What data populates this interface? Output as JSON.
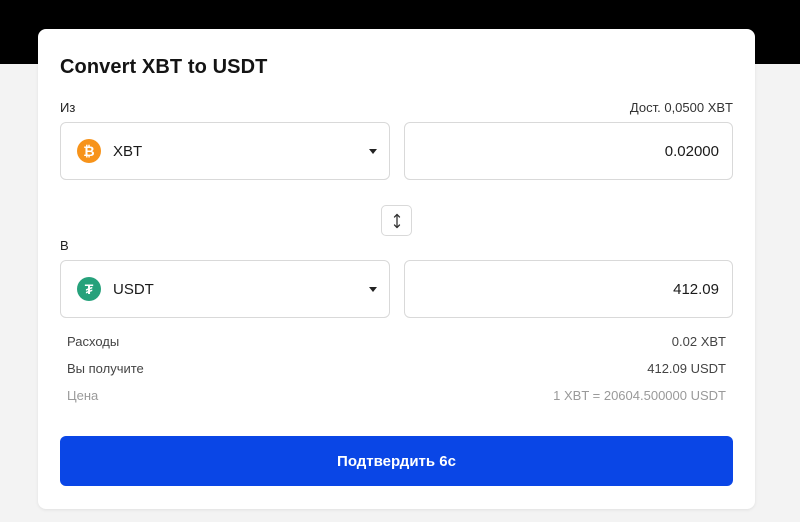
{
  "title": "Convert XBT to USDT",
  "from": {
    "label": "Из",
    "available": "Дост. 0,0500 XBT",
    "coin": "XBT",
    "icon": "bitcoin-icon",
    "icon_glyph": "₿",
    "icon_color": "#f7931a",
    "amount": "0.02000"
  },
  "to": {
    "label": "В",
    "coin": "USDT",
    "icon": "tether-icon",
    "icon_glyph": "₮",
    "icon_color": "#26a17b",
    "amount": "412.09"
  },
  "summary": {
    "fee_label": "Расходы",
    "fee_value": "0.02 XBT",
    "receive_label": "Вы получите",
    "receive_value": "412.09 USDT",
    "price_label": "Цена",
    "price_value": "1 XBT = 20604.500000 USDT"
  },
  "confirm_label": "Подтвердить 6с",
  "colors": {
    "accent": "#0a46e6",
    "header_band": "#000000"
  }
}
